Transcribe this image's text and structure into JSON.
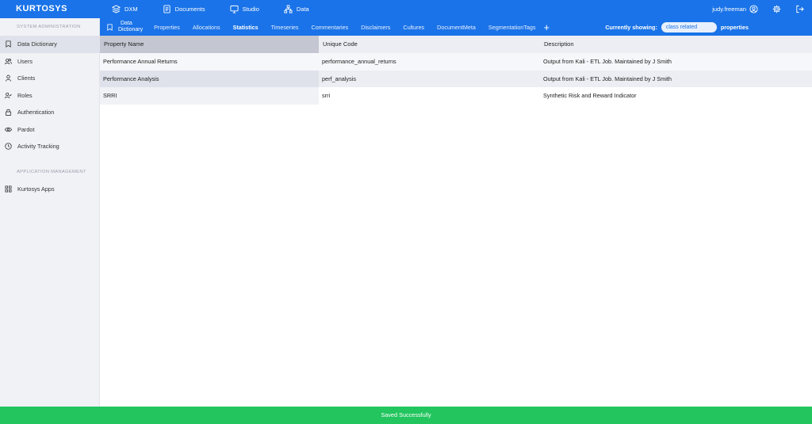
{
  "app": {
    "logo": "KURTOSYS"
  },
  "topnav": {
    "items": [
      {
        "label": "DXM",
        "icon": "layers-icon"
      },
      {
        "label": "Documents",
        "icon": "documents-icon"
      },
      {
        "label": "Studio",
        "icon": "monitor-icon"
      },
      {
        "label": "Data",
        "icon": "hierarchy-icon"
      }
    ],
    "user": "judy.freeman"
  },
  "sidebar": {
    "section1": "SYSTEM ADMINISTRATION",
    "items": [
      {
        "label": "Data Dictionary",
        "icon": "bookmark-icon",
        "active": true
      },
      {
        "label": "Users",
        "icon": "users-icon"
      },
      {
        "label": "Clients",
        "icon": "user-icon"
      },
      {
        "label": "Roles",
        "icon": "user-check-icon"
      },
      {
        "label": "Authentication",
        "icon": "lock-icon"
      },
      {
        "label": "Pardot",
        "icon": "eye-icon"
      },
      {
        "label": "Activity Tracking",
        "icon": "clock-icon"
      }
    ],
    "section2": "APPLICATION MANAGEMENT",
    "items2": [
      {
        "label": "Kurtosys Apps",
        "icon": "grid-icon"
      }
    ]
  },
  "subnav": {
    "dropdown_line1": "Data",
    "dropdown_line2": "Dictionary",
    "tabs": [
      "Properties",
      "Allocations",
      "Statistics",
      "Timeseries",
      "Commentaries",
      "Disclaimers",
      "Cultures",
      "DocumentMeta",
      "SegmentationTags"
    ],
    "active_tab": "Statistics",
    "showing_label": "Currently showing:",
    "showing_value": "class related",
    "showing_suffix": "properties"
  },
  "table": {
    "headers": [
      "Property Name",
      "Unique Code",
      "Description"
    ],
    "rows": [
      [
        "Performance Annual Returns",
        "performance_annual_returns",
        "Output from Kali - ETL Job. Maintained by J Smith"
      ],
      [
        "Performance Analysis",
        "perf_analysis",
        "Output from Kali - ETL Job. Maintained by J Smith"
      ],
      [
        "SRRI",
        "srri",
        "Synthetic Risk and Reward Indicator"
      ]
    ]
  },
  "toast": {
    "message": "Saved Successfully"
  },
  "colors": {
    "primary": "#1a73e8",
    "success": "#22c55e",
    "sidebar_bg": "#f1f2f6"
  }
}
